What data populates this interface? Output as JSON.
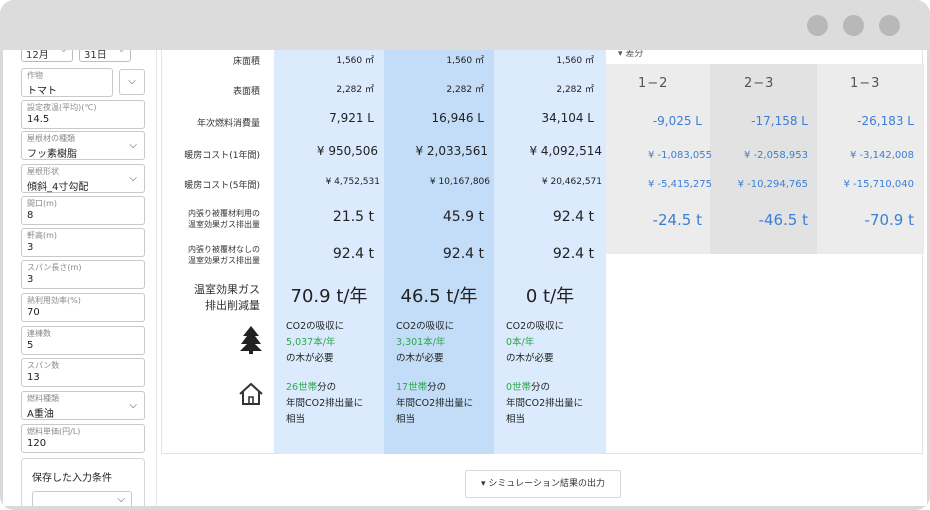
{
  "sidebar": {
    "month": "12月",
    "day": "31日",
    "crop": {
      "label": "作物",
      "value": "トマト"
    },
    "setting_temp": {
      "label": "設定夜温(平均)(℃)",
      "value": "14.5"
    },
    "roof_material": {
      "label": "屋根材の種類",
      "value": "フッ素樹脂"
    },
    "roof_shape": {
      "label": "屋根形状",
      "value": "傾斜_4寸勾配"
    },
    "frontage": {
      "label": "間口(m)",
      "value": "8"
    },
    "eaves_height": {
      "label": "軒高(m)",
      "value": "3"
    },
    "span_length": {
      "label": "スパン長さ(m)",
      "value": "3"
    },
    "heat_efficiency": {
      "label": "熱利用効率(%)",
      "value": "70"
    },
    "num_buildings": {
      "label": "連棟数",
      "value": "5"
    },
    "num_spans": {
      "label": "スパン数",
      "value": "13"
    },
    "fuel_type": {
      "label": "燃料種類",
      "value": "A重油"
    },
    "fuel_price": {
      "label": "燃料単価(円/L)",
      "value": "120"
    },
    "saved_conditions": "保存した入力条件"
  },
  "table": {
    "row_labels": {
      "floor_area": "床面積",
      "surface_area": "表面積",
      "annual_fuel": "年次燃料消費量",
      "heating_cost_1y": "暖房コスト(1年間)",
      "heating_cost_5y": "暖房コスト(5年間)",
      "with_cover_1": "内張り被覆材利用の",
      "with_cover_2": "温室効果ガス排出量",
      "without_cover_1": "内張り被覆材なしの",
      "without_cover_2": "温室効果ガス排出量",
      "reduction_1": "温室効果ガス",
      "reduction_2": "排出削減量"
    },
    "columns": [
      {
        "floor_area": "1,560 ㎡",
        "surface_area": "2,282 ㎡",
        "annual_fuel": "7,921 L",
        "cost_1y": "¥ 950,506",
        "cost_5y": "¥ 4,752,531",
        "with_cover": "21.5 t",
        "without_cover": "92.4 t",
        "reduction": "70.9 t/年",
        "tree_1": "CO2の吸収に",
        "tree_2": "5,037本/年",
        "tree_3": "の木が必要",
        "house_1": "26世帯",
        "house_1b": "分の",
        "house_2": "年間CO2排出量に",
        "house_3": "相当"
      },
      {
        "floor_area": "1,560 ㎡",
        "surface_area": "2,282 ㎡",
        "annual_fuel": "16,946 L",
        "cost_1y": "¥ 2,033,561",
        "cost_5y": "¥ 10,167,806",
        "with_cover": "45.9 t",
        "without_cover": "92.4 t",
        "reduction": "46.5 t/年",
        "tree_1": "CO2の吸収に",
        "tree_2": "3,301本/年",
        "tree_3": "の木が必要",
        "house_1": "17世帯",
        "house_1b": "分の",
        "house_2": "年間CO2排出量に",
        "house_3": "相当"
      },
      {
        "floor_area": "1,560 ㎡",
        "surface_area": "2,282 ㎡",
        "annual_fuel": "34,104 L",
        "cost_1y": "¥ 4,092,514",
        "cost_5y": "¥ 20,462,571",
        "with_cover": "92.4 t",
        "without_cover": "92.4 t",
        "reduction": "0 t/年",
        "tree_1": "CO2の吸収に",
        "tree_2": "0本/年",
        "tree_3": "の木が必要",
        "house_1": "0世帯",
        "house_1b": "分の",
        "house_2": "年間CO2排出量に",
        "house_3": "相当"
      }
    ]
  },
  "diff": {
    "header": "▾ 差分",
    "columns": [
      {
        "head": "1−2",
        "fuel": "-9,025 L",
        "cost_1y": "¥ -1,083,055",
        "cost_5y": "¥ -5,415,275",
        "emission": "-24.5 t"
      },
      {
        "head": "2−3",
        "fuel": "-17,158 L",
        "cost_1y": "¥ -2,058,953",
        "cost_5y": "¥ -10,294,765",
        "emission": "-46.5 t"
      },
      {
        "head": "1−3",
        "fuel": "-26,183 L",
        "cost_1y": "¥ -3,142,008",
        "cost_5y": "¥ -15,710,040",
        "emission": "-70.9 t"
      }
    ]
  },
  "export_button": "▾ シミュレーション結果の出力",
  "colors": {
    "diff_text": "#3a7fd5",
    "green": "#2ea84a",
    "col_light": "#dbeafd",
    "col_mid": "#c3dcf7"
  }
}
